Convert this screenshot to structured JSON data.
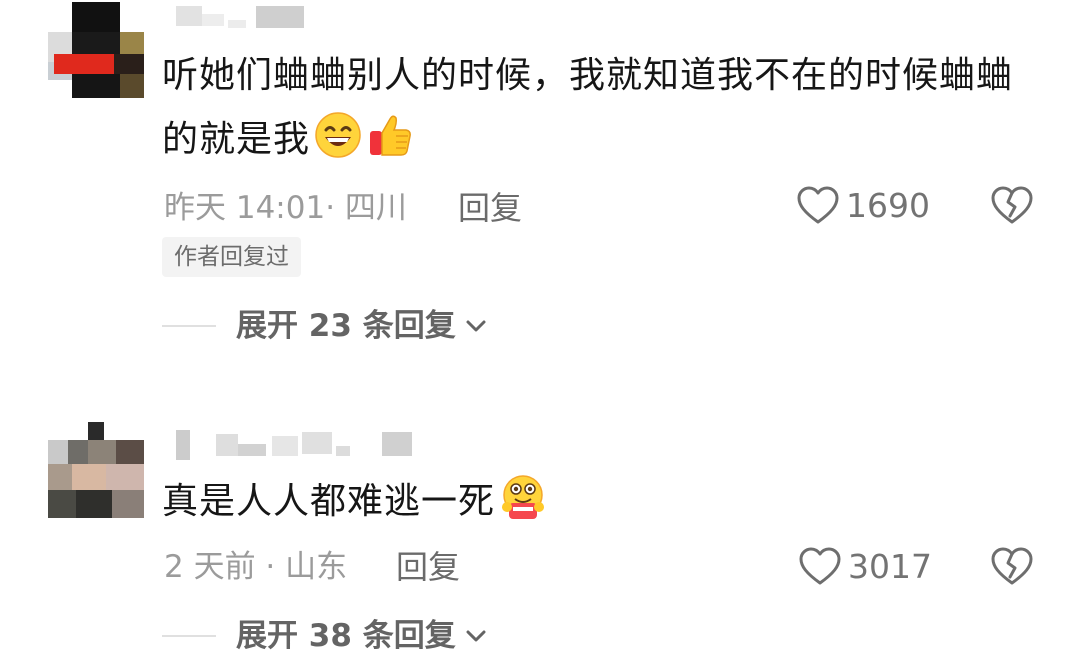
{
  "comments": [
    {
      "content": "听她们蛐蛐别人的时候，我就知道我不在的时候蛐蛐的就是我",
      "emojis": [
        "grinning-face-emoji",
        "thumbs-up-emoji"
      ],
      "meta": "昨天 14:01· 四川",
      "reply_label": "回复",
      "like_count": "1690",
      "author_tag": "作者回复过",
      "expand_label": "展开 23 条回复",
      "icons": {
        "like": "heart-outline-icon",
        "dislike": "broken-heart-icon",
        "expand": "chevron-down-icon"
      }
    },
    {
      "content": "真是人人都难逃一死",
      "emojis": [
        "eating-popcorn-emoji"
      ],
      "meta": "2 天前 · 山东",
      "reply_label": "回复",
      "like_count": "3017",
      "expand_label": "展开 38 条回复",
      "icons": {
        "like": "heart-outline-icon",
        "dislike": "broken-heart-icon",
        "expand": "chevron-down-icon"
      }
    }
  ],
  "colors": {
    "text": "#161616",
    "meta": "#9b9b9b",
    "like_count": "#737373",
    "tag_bg": "#f3f3f3"
  }
}
